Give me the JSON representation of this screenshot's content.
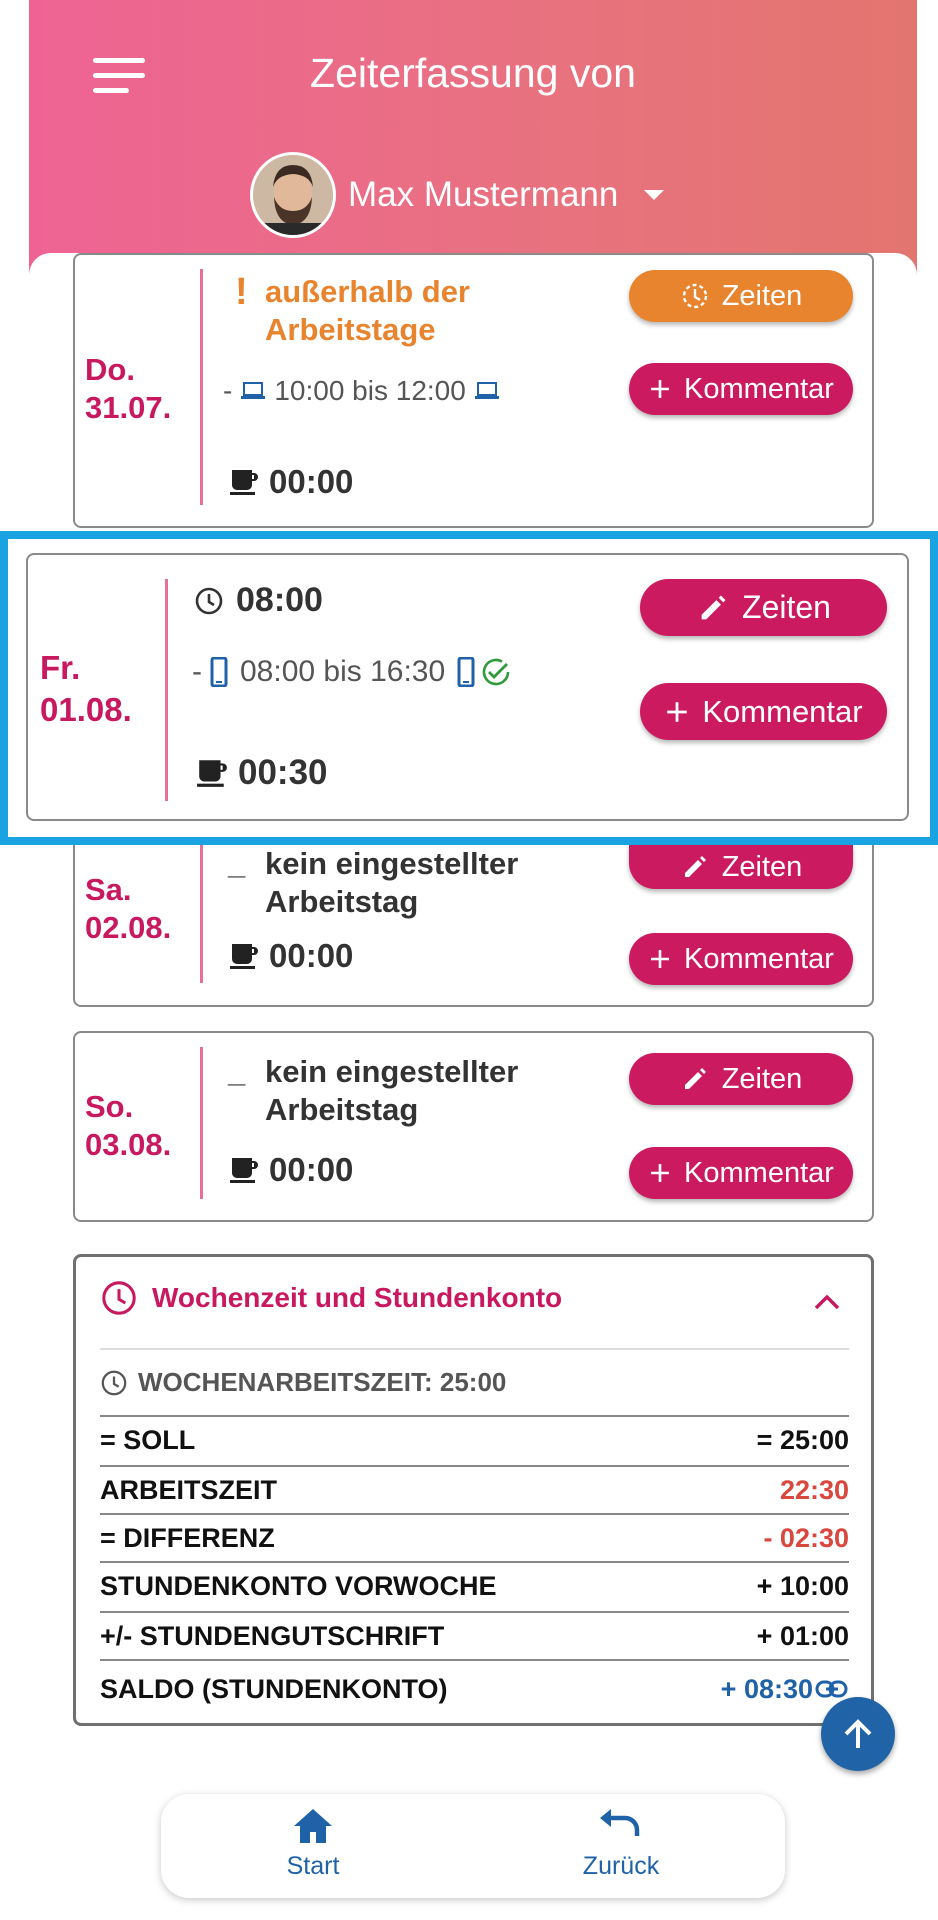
{
  "header": {
    "title": "Zeiterfassung von",
    "user_name": "Max Mustermann"
  },
  "days": [
    {
      "day": "Do.",
      "date": "31.07.",
      "status_mark": "!",
      "status_line1": "außerhalb der",
      "status_line2": "Arbeitstage",
      "time_prefix": "-",
      "time_range": "10:00 bis 12:00",
      "pause": "00:00",
      "btn_zeiten": "Zeiten",
      "btn_kommentar": "Kommentar"
    },
    {
      "day": "Fr.",
      "date": "01.08.",
      "worked": "08:00",
      "time_prefix": "-",
      "time_range": "08:00 bis 16:30",
      "pause": "00:30",
      "btn_zeiten": "Zeiten",
      "btn_kommentar": "Kommentar"
    },
    {
      "day": "Sa.",
      "date": "02.08.",
      "status_mark": "_",
      "status_line1": "kein eingestellter",
      "status_line2": "Arbeitstag",
      "pause": "00:00",
      "btn_zeiten": "Zeiten",
      "btn_kommentar": "Kommentar"
    },
    {
      "day": "So.",
      "date": "03.08.",
      "status_mark": "_",
      "status_line1": "kein eingestellter",
      "status_line2": "Arbeitstag",
      "pause": "00:00",
      "btn_zeiten": "Zeiten",
      "btn_kommentar": "Kommentar"
    }
  ],
  "summary": {
    "title": "Wochenzeit und Stundenkonto",
    "weekly_hours": "WOCHENARBEITSZEIT: 25:00",
    "rows": [
      {
        "label": "= SOLL",
        "value": "= 25:00",
        "color": "#111111"
      },
      {
        "label": "ARBEITSZEIT",
        "value": "22:30",
        "color": "#d9473f"
      },
      {
        "label": "= DIFFERENZ",
        "value": "- 02:30",
        "color": "#d9473f"
      },
      {
        "label": "STUNDENKONTO VORWOCHE",
        "value": "+ 10:00",
        "color": "#111111"
      },
      {
        "label": "+/- STUNDENGUTSCHRIFT",
        "value": "+ 01:00",
        "color": "#111111"
      },
      {
        "label": "SALDO (STUNDENKONTO)",
        "value": "+ 08:30",
        "color": "#1f62a8"
      }
    ]
  },
  "nav": {
    "start": "Start",
    "back": "Zurück"
  },
  "colors": {
    "brand": "#cc1a60",
    "orange": "#e8832e",
    "blue": "#1f62a8",
    "highlight": "#1aa3e3",
    "negative": "#d9473f",
    "success": "#2e9a3a"
  }
}
